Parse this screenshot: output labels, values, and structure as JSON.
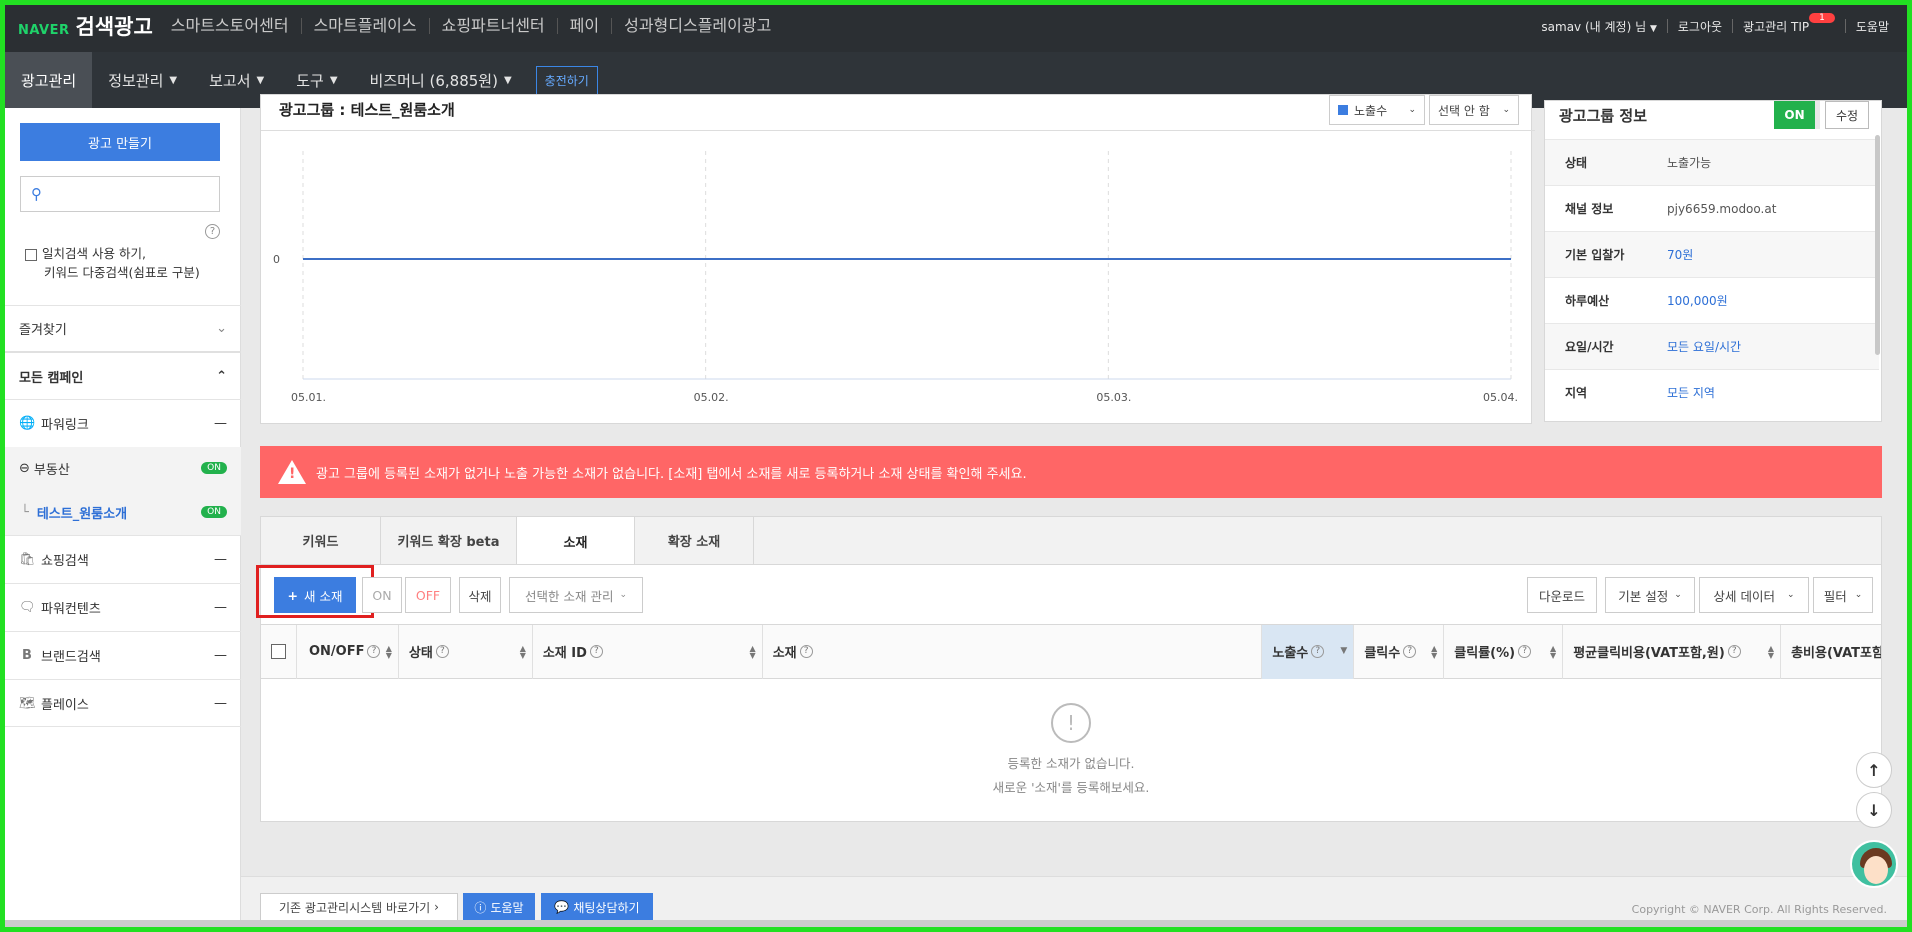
{
  "topbar": {
    "brand_naver": "NAVER",
    "brand_title": "검색광고",
    "nav": [
      "스마트스토어센터",
      "스마트플레이스",
      "쇼핑파트너센터",
      "페이",
      "성과형디스플레이광고"
    ],
    "user": "samav (내 계정) 님",
    "logout": "로그아웃",
    "tip": "광고관리 TIP",
    "tip_badge": "1",
    "help": "도움말"
  },
  "navbar": {
    "ad_manage": "광고관리",
    "info_manage": "정보관리",
    "report": "보고서",
    "tools": "도구",
    "bizmoney": "비즈머니 (6,885원)",
    "charge": "충전하기"
  },
  "sidebar": {
    "create_ad": "광고 만들기",
    "exact_search_line1": "일치검색 사용 하기,",
    "exact_search_line2": "키워드 다중검색(쉼표로 구분)",
    "favorites": "즐겨찾기",
    "all_campaigns": "모든 캠페인",
    "powerlink": "파워링크",
    "realestate": "부동산",
    "adgroup": "테스트_원룸소개",
    "on_label": "ON",
    "shopping": "쇼핑검색",
    "powercontents": "파워컨텐츠",
    "brandsearch": "브랜드검색",
    "place": "플레이스"
  },
  "chart_card": {
    "title": "광고그룹 : 테스트_원룸소개",
    "metric_dropdown": "노출수",
    "compare_dropdown": "선택 안 함"
  },
  "chart_data": {
    "type": "line",
    "x": [
      "05.01.",
      "05.02.",
      "05.03.",
      "05.04."
    ],
    "series": [
      {
        "values": [
          0,
          0,
          0,
          0
        ]
      }
    ],
    "ytick": "0",
    "color": "#3c6fc6"
  },
  "info_card": {
    "title": "광고그룹 정보",
    "on": "ON",
    "edit": "수정",
    "rows": [
      {
        "k": "상태",
        "v": "노출가능"
      },
      {
        "k": "채널 정보",
        "v": "pjy6659.modoo.at"
      },
      {
        "k": "기본 입찰가",
        "v": "70원"
      },
      {
        "k": "하루예산",
        "v": "100,000원"
      },
      {
        "k": "요일/시간",
        "v": "모든 요일/시간"
      },
      {
        "k": "지역",
        "v": "모든 지역"
      }
    ]
  },
  "alert": {
    "text": "광고 그룹에 등록된 소재가 없거나 노출 가능한 소재가 없습니다. [소재] 탭에서 소재를 새로 등록하거나 소재 상태를 확인해 주세요."
  },
  "tabs": [
    "키워드",
    "키워드 확장 beta",
    "소재",
    "확장 소재"
  ],
  "toolbar": {
    "new": "새 소재",
    "on": "ON",
    "off": "OFF",
    "delete": "삭제",
    "manage": "선택한 소재 관리",
    "download": "다운로드",
    "basic": "기본 설정",
    "detail": "상세 데이터",
    "filter": "필터"
  },
  "table": {
    "cols": [
      "ON/OFF",
      "상태",
      "소재 ID",
      "소재",
      "노출수",
      "클릭수",
      "클릭률(%)",
      "평균클릭비용(VAT포함,원)",
      "총비용(VAT포함,원"
    ],
    "empty1": "등록한 소재가 없습니다.",
    "empty2": "새로운 '소재'를 등록해보세요."
  },
  "footer": {
    "legacy": "기존 광고관리시스템 바로가기",
    "help": "도움말",
    "chat": "채팅상담하기",
    "copyright": "Copyright © NAVER Corp. All Rights Reserved."
  }
}
